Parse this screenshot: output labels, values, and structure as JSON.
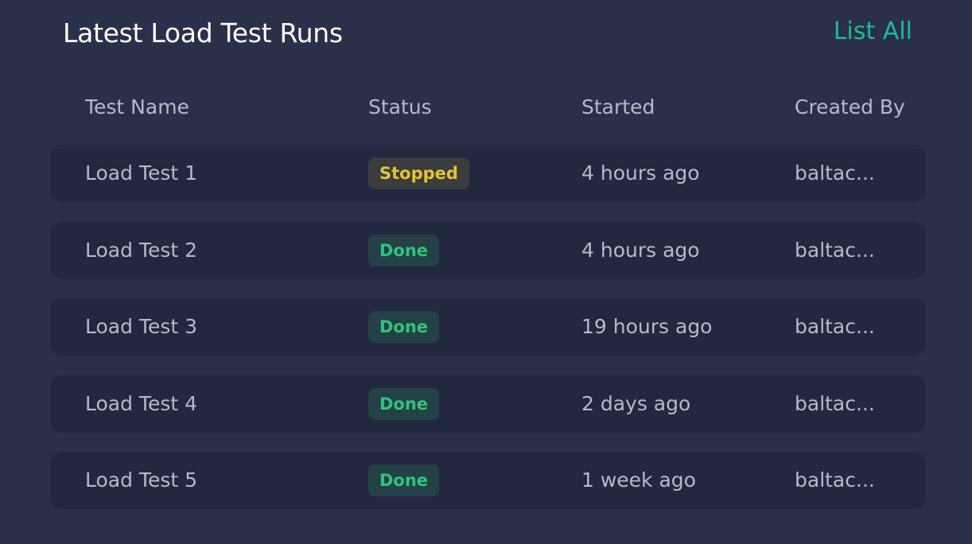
{
  "header": {
    "title": "Latest Load Test Runs",
    "list_all_label": "List All"
  },
  "colors": {
    "accent": "#1fb995",
    "stopped": "#e4c52a",
    "done": "#2ec57a"
  },
  "table": {
    "columns": [
      "Test Name",
      "Status",
      "Started",
      "Created By"
    ],
    "rows": [
      {
        "name": "Load Test 1",
        "status": "Stopped",
        "status_kind": "stopped",
        "started": "4 hours ago",
        "created_by": "baltac..."
      },
      {
        "name": "Load Test 2",
        "status": "Done",
        "status_kind": "done",
        "started": "4 hours ago",
        "created_by": "baltac..."
      },
      {
        "name": "Load Test 3",
        "status": "Done",
        "status_kind": "done",
        "started": "19 hours ago",
        "created_by": "baltac..."
      },
      {
        "name": "Load Test 4",
        "status": "Done",
        "status_kind": "done",
        "started": "2 days ago",
        "created_by": "baltac..."
      },
      {
        "name": "Load Test 5",
        "status": "Done",
        "status_kind": "done",
        "started": "1 week ago",
        "created_by": "baltac..."
      }
    ]
  }
}
